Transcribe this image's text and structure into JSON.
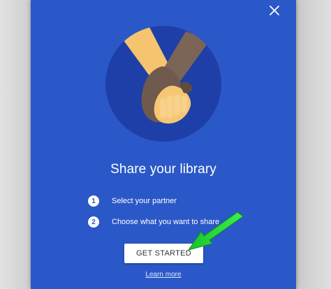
{
  "dialog": {
    "close_icon": "close-icon",
    "illustration_icon": "holding-hands-icon",
    "title": "Share your library",
    "steps": [
      {
        "number": "1",
        "label": "Select your partner"
      },
      {
        "number": "2",
        "label": "Choose what you want to share"
      }
    ],
    "cta_label": "GET STARTED",
    "learn_more_label": "Learn more"
  },
  "colors": {
    "dialog_bg": "#2b58c8",
    "illustration_circle": "#1f3fa8",
    "arrow": "#22dd33"
  }
}
